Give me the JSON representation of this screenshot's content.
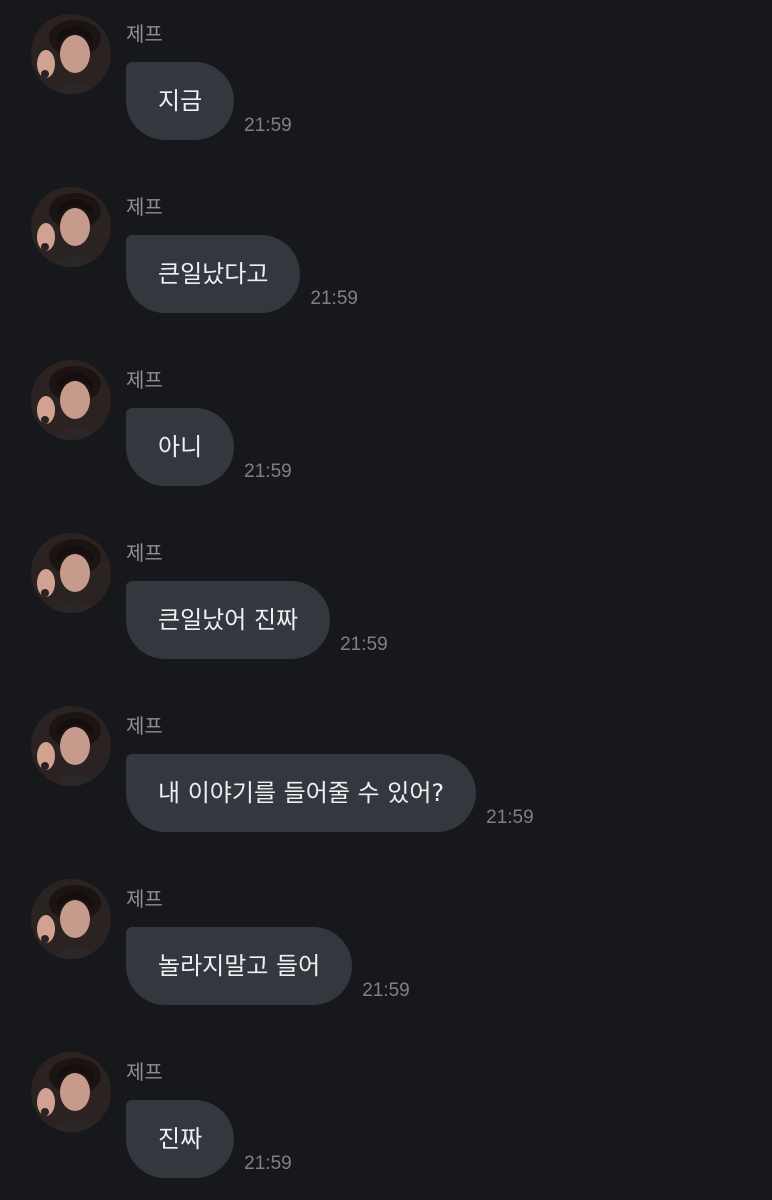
{
  "messages": [
    {
      "sender": "제프",
      "text": "지금",
      "time": "21:59"
    },
    {
      "sender": "제프",
      "text": "큰일났다고",
      "time": "21:59"
    },
    {
      "sender": "제프",
      "text": "아니",
      "time": "21:59"
    },
    {
      "sender": "제프",
      "text": "큰일났어 진짜",
      "time": "21:59"
    },
    {
      "sender": "제프",
      "text": "내 이야기를 들어줄 수 있어?",
      "time": "21:59"
    },
    {
      "sender": "제프",
      "text": "놀라지말고 들어",
      "time": "21:59"
    },
    {
      "sender": "제프",
      "text": "진짜",
      "time": "21:59"
    }
  ],
  "theme": {
    "background": "#17181c",
    "bubble": "#34373e",
    "text": "#eeeff2",
    "meta": "#8e8f95"
  },
  "icons": {
    "avatar": "profile-photo"
  }
}
